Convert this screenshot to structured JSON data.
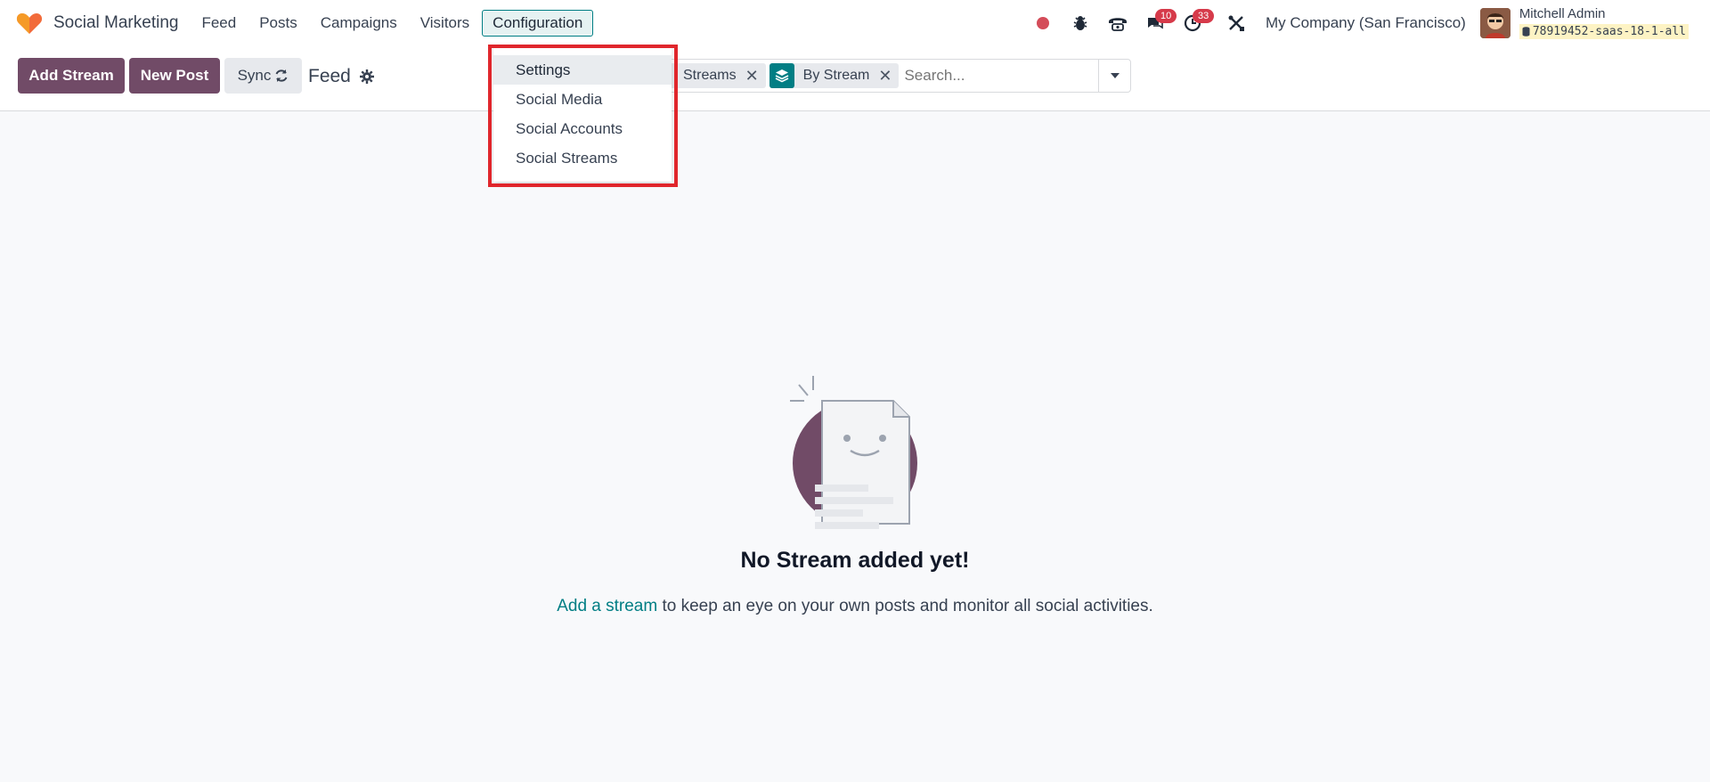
{
  "app": {
    "name": "Social Marketing",
    "logo_icon": "heart-logo-icon"
  },
  "menu": [
    {
      "label": "Feed"
    },
    {
      "label": "Posts"
    },
    {
      "label": "Campaigns"
    },
    {
      "label": "Visitors"
    },
    {
      "label": "Configuration",
      "active": true
    }
  ],
  "systray": {
    "messages_count": "10",
    "activities_count": "33",
    "company": "My Company (San Francisco)",
    "user_name": "Mitchell Admin",
    "database": "78919452-saas-18-1-all"
  },
  "control": {
    "add_stream_label": "Add Stream",
    "new_post_label": "New Post",
    "sync_label": "Sync",
    "view_title": "Feed"
  },
  "search": {
    "facets": [
      {
        "label": "Streams"
      },
      {
        "label": "By Stream"
      }
    ],
    "placeholder": "Search..."
  },
  "dropdown": {
    "items": [
      {
        "label": "Settings"
      },
      {
        "label": "Social Media"
      },
      {
        "label": "Social Accounts"
      },
      {
        "label": "Social Streams"
      }
    ]
  },
  "empty_state": {
    "title": "No Stream added yet!",
    "link_text": "Add a stream",
    "text": " to keep an eye on your own posts and monitor all social activities."
  },
  "colors": {
    "primary": "#714b67",
    "accent": "#017e84",
    "badge": "#d63a4a",
    "highlight": "#e0262c"
  }
}
